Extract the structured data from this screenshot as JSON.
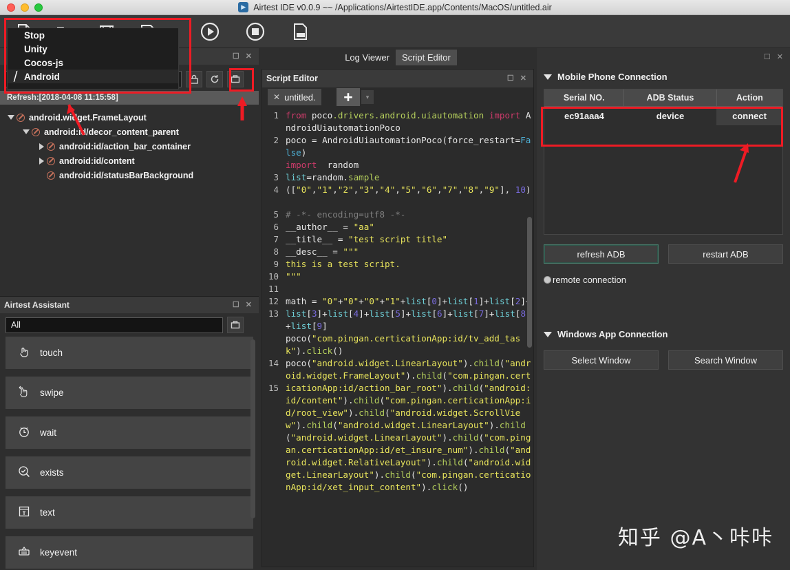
{
  "window": {
    "title": "Airtest IDE v0.0.9 ~~ /Applications/AirtestIDE.app/Contents/MacOS/untitled.air",
    "logo_icon": "airtest-logo-icon"
  },
  "toolbar": {
    "items": [
      {
        "name": "new-file-icon",
        "label": ""
      },
      {
        "name": "open-folder-icon",
        "label": ""
      },
      {
        "name": "save-icon",
        "label": ""
      },
      {
        "name": "save-as-icon",
        "label": ""
      },
      {
        "name": "run-icon",
        "label": ""
      },
      {
        "name": "stop-icon",
        "label": ""
      },
      {
        "name": "log-icon",
        "label": ""
      }
    ]
  },
  "dropdown": {
    "open": true,
    "items": [
      "Stop",
      "Unity",
      "Cocos-js",
      "Android"
    ],
    "selected": "Android"
  },
  "tree_panel": {
    "combo_value": "Android",
    "refresh_text": "Refresh:[2018-04-08 11:15:58]",
    "buttons": [
      "lock-icon",
      "refresh-icon",
      "device-capture-icon"
    ],
    "nodes": [
      {
        "label": "android.widget.FrameLayout",
        "depth": 0,
        "twisty": "down"
      },
      {
        "label": "android:id/decor_content_parent",
        "depth": 1,
        "twisty": "down"
      },
      {
        "label": "android:id/action_bar_container",
        "depth": 2,
        "twisty": "right"
      },
      {
        "label": "android:id/content",
        "depth": 2,
        "twisty": "right"
      },
      {
        "label": "android:id/statusBarBackground",
        "depth": 2,
        "twisty": "none"
      }
    ]
  },
  "assistant": {
    "title": "Airtest Assistant",
    "filter_value": "All",
    "items": [
      {
        "label": "touch",
        "icon": "touch-hand-icon"
      },
      {
        "label": "swipe",
        "icon": "swipe-hand-icon"
      },
      {
        "label": "wait",
        "icon": "clock-icon"
      },
      {
        "label": "exists",
        "icon": "check-magnifier-icon"
      },
      {
        "label": "text",
        "icon": "text-input-icon"
      },
      {
        "label": "keyevent",
        "icon": "keyboard-icon"
      }
    ]
  },
  "editor": {
    "view_tabs": [
      {
        "label": "Log Viewer",
        "active": false
      },
      {
        "label": "Script Editor",
        "active": true
      }
    ],
    "panel_title": "Script Editor",
    "file_tab": "untitled.",
    "add_tab_label": "+",
    "line_numbers": [
      "1",
      "2",
      "3",
      "4",
      "5",
      "6",
      "7",
      "8",
      "9",
      "10",
      "11",
      "12",
      "13",
      "14",
      "15"
    ]
  },
  "connection": {
    "mobile_section_title": "Mobile Phone Connection",
    "table": {
      "headers": [
        "Serial NO.",
        "ADB Status",
        "Action"
      ],
      "rows": [
        [
          "ec91aaa4",
          "device",
          "connect"
        ]
      ]
    },
    "refresh_adb_label": "refresh ADB",
    "restart_adb_label": "restart ADB",
    "remote_connection_label": "remote connection",
    "windows_section_title": "Windows App Connection",
    "select_window_label": "Select Window",
    "search_window_label": "Search Window"
  },
  "watermark": "知乎 @A丶咔咔",
  "colors": {
    "annotation": "#ee1b24",
    "panel_bg": "#2e2e2e",
    "toolbar_bg": "#3a3a3a",
    "code_bg": "#2b2b2b"
  }
}
